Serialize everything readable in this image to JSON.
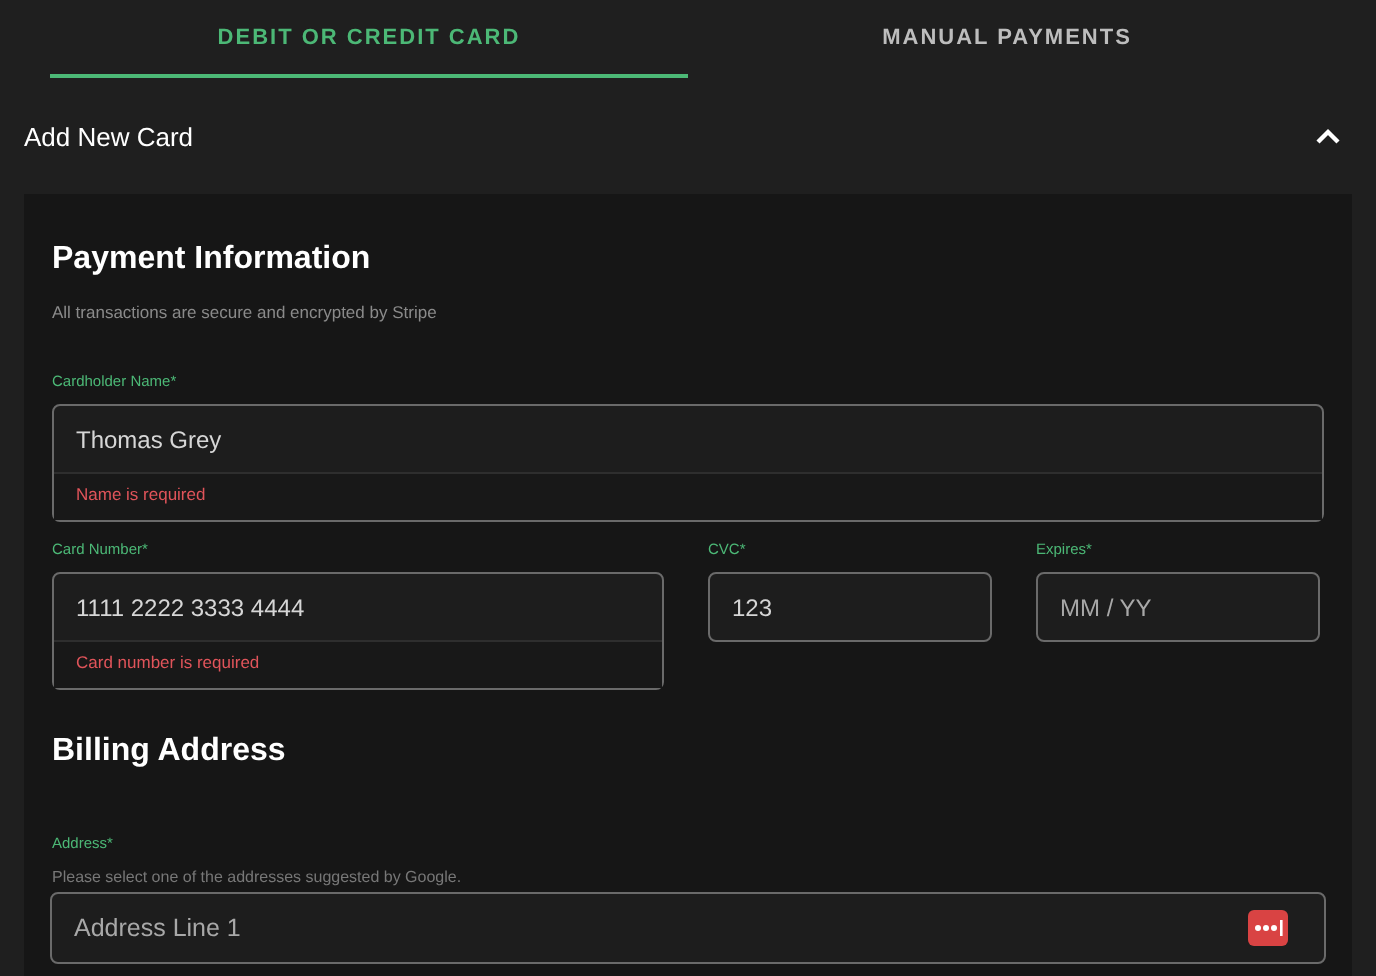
{
  "tabs": [
    {
      "label": "DEBIT OR CREDIT CARD",
      "selected": true
    },
    {
      "label": "MANUAL PAYMENTS",
      "selected": false
    }
  ],
  "section": {
    "title": "Add New Card",
    "expanded": true
  },
  "payment": {
    "title": "Payment Information",
    "subtitle": "All transactions are secure and encrypted by Stripe",
    "fields": [
      {
        "label": "Cardholder Name*",
        "value": "Thomas Grey",
        "error": "Name is required"
      },
      {
        "label": "Card Number*",
        "value": "1111 2222 3333 4444",
        "error": "Card number is required"
      },
      {
        "label": "CVC*",
        "value": "123"
      },
      {
        "label": "Expires*",
        "placeholder": "MM / YY"
      }
    ]
  },
  "billing": {
    "title": "Billing Address",
    "label": "Address*",
    "hint": "Please select one of the addresses suggested by Google.",
    "placeholder": "Address Line 1"
  }
}
